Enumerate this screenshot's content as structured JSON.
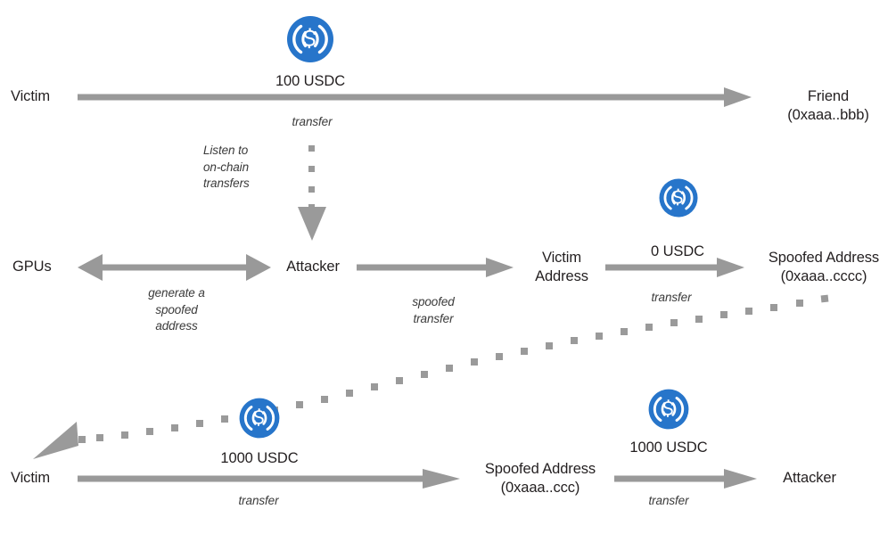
{
  "diagram": {
    "title": "Address poisoning attack flow",
    "colors": {
      "arrow_gray": "#999999",
      "dotted_gray": "#9a9a9a",
      "text_dark": "#231f20",
      "usdc_blue": "#2775ca",
      "background": "#ffffff"
    },
    "coin_icon_name": "usdc-coin-icon"
  },
  "nodes": {
    "victim_top": "Victim",
    "friend": "Friend\n(0xaaa..bbb)",
    "friend_line1": "Friend",
    "friend_line2": "(0xaaa..bbb)",
    "gpus": "GPUs",
    "attacker_mid": "Attacker",
    "victim_address_line1": "Victim",
    "victim_address_line2": "Address",
    "spoofed_address_mid_line1": "Spoofed Address",
    "spoofed_address_mid_line2": "(0xaaa..cccc)",
    "victim_bottom": "Victim",
    "spoofed_address_bottom_line1": "Spoofed Address",
    "spoofed_address_bottom_line2": "(0xaaa..ccc)",
    "attacker_bottom": "Attacker"
  },
  "amounts": {
    "top_transfer": "100 USDC",
    "zero_transfer": "0 USDC",
    "bottom_left_transfer": "1000 USDC",
    "bottom_right_transfer": "1000 USDC"
  },
  "edges": {
    "victim_to_friend": "transfer",
    "listen_on_chain": "Listen to\non-chain\ntransfers",
    "gpus_generate": "generate a\nspoofed\naddress",
    "attacker_spoofed": "spoofed\ntransfer",
    "victim_address_to_spoofed": "transfer",
    "victim_to_spoofed_bottom": "transfer",
    "spoofed_to_attacker_bottom": "transfer"
  }
}
